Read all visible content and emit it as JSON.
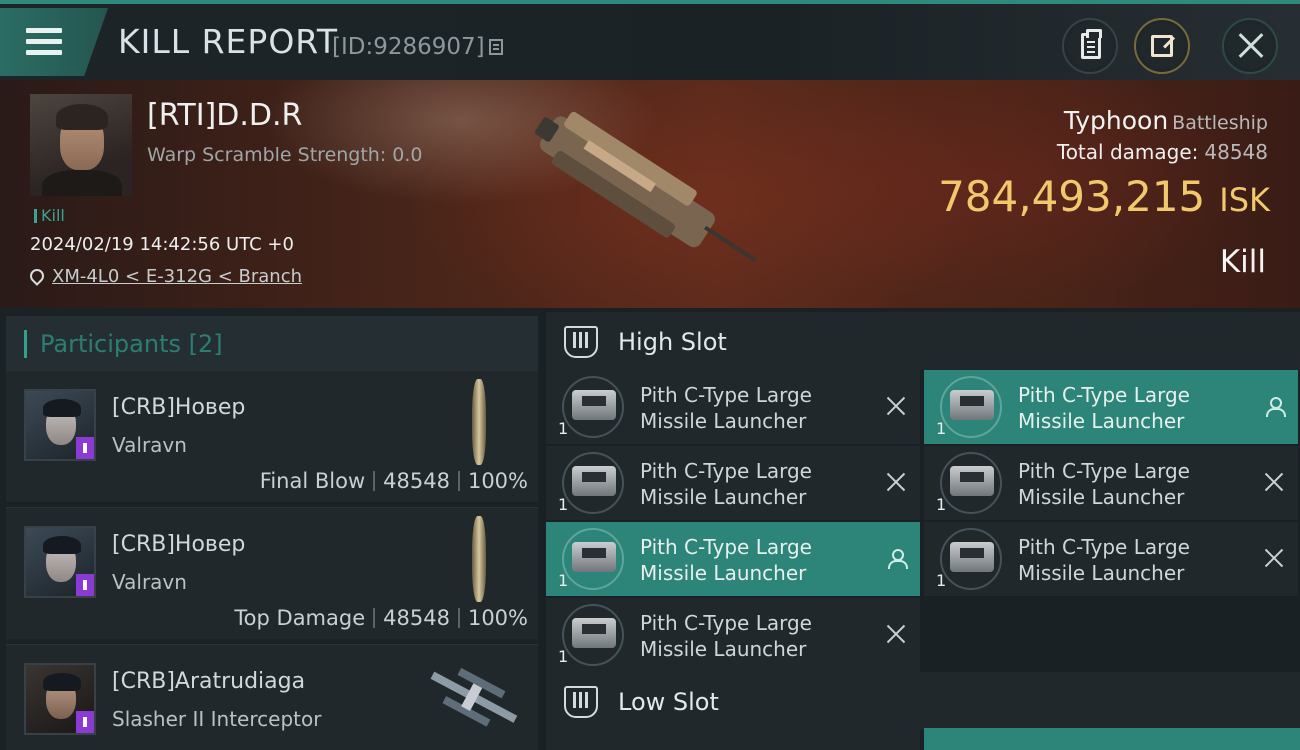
{
  "header": {
    "title": "KILL REPORT",
    "report_id": "[ID:9286907]"
  },
  "victim": {
    "name": "[RTI]D.D.R",
    "warp_scramble": "Warp Scramble Strength: 0.0",
    "tag": "Kill",
    "datetime": "2024/02/19 14:42:56 UTC +0",
    "location": "XM-4L0 < E-312G < Branch",
    "ship_name": "Typhoon",
    "ship_class": "Battleship",
    "total_damage_label": "Total damage:",
    "total_damage": "48548",
    "isk_value": "784,493,215",
    "isk_unit": "ISK",
    "result": "Kill"
  },
  "participants": {
    "title": "Participants [2]",
    "items": [
      {
        "name": "[CRB]Новер",
        "ship": "Valravn",
        "role": "Final Blow",
        "damage": "48548",
        "percent": "100%"
      },
      {
        "name": "[CRB]Новер",
        "ship": "Valravn",
        "role": "Top Damage",
        "damage": "48548",
        "percent": "100%"
      },
      {
        "name": "[CRB]Aratrudiaga",
        "ship": "Slasher II Interceptor",
        "role": "",
        "damage": "",
        "percent": ""
      }
    ]
  },
  "fitting": {
    "high_slot_title": "High Slot",
    "low_slot_title": "Low Slot",
    "modules": [
      {
        "name": "Pith C-Type Large Missile Launcher",
        "qty": "1",
        "status": "destroyed"
      },
      {
        "name": "Pith C-Type Large Missile Launcher",
        "qty": "1",
        "status": "dropped"
      },
      {
        "name": "Pith C-Type Large Missile Launcher",
        "qty": "1",
        "status": "destroyed"
      },
      {
        "name": "Pith C-Type Large Missile Launcher",
        "qty": "1",
        "status": "destroyed"
      },
      {
        "name": "Pith C-Type Large Missile Launcher",
        "qty": "1",
        "status": "dropped"
      },
      {
        "name": "Pith C-Type Large Missile Launcher",
        "qty": "1",
        "status": "destroyed"
      },
      {
        "name": "Pith C-Type Large Missile Launcher",
        "qty": "1",
        "status": "destroyed"
      }
    ]
  },
  "colors": {
    "accent_teal": "#2d8478",
    "isk_gold": "#f1c96c",
    "badge_purple": "#8b3bd4"
  }
}
